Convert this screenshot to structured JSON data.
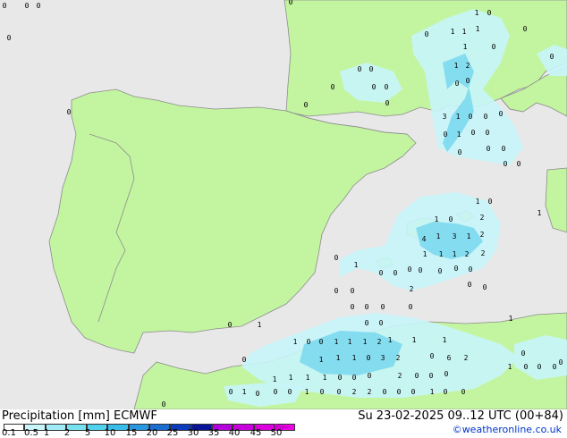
{
  "title": "Precipitation [mm]  ECMWF",
  "valid_time": "Su 23-02-2025 09..12 UTC (00+84)",
  "credit": "©weatheronline.co.uk",
  "legend": {
    "ticks": [
      "0.1",
      "0.5",
      "1",
      "2",
      "5",
      "10",
      "15",
      "20",
      "25",
      "30",
      "35",
      "40",
      "45",
      "50"
    ],
    "colors": [
      "#ffffff",
      "#c8f5fa",
      "#a0ebf5",
      "#78e1f0",
      "#50d2ee",
      "#38bcea",
      "#2896e0",
      "#1a6ed2",
      "#0c3cbe",
      "#0a149a",
      "#b400dc",
      "#c800dc",
      "#dc00dc",
      "#f000e6"
    ]
  },
  "colors": {
    "sea": "#e8e8e8",
    "land": "#c3f5a0",
    "border": "#8c8c8c",
    "precip_light": "#c8f5fa",
    "precip_mid": "#a0ebf5",
    "precip_heavy": "#78d7ee"
  },
  "map_labels": [
    "0",
    "0",
    "0",
    "0",
    "0",
    "0",
    "1",
    "0",
    "0",
    "1",
    "1",
    "1",
    "1",
    "1",
    "2",
    "0",
    "0",
    "0",
    "0",
    "0",
    "0",
    "0",
    "0",
    "0",
    "0",
    "0",
    "0",
    "3",
    "1",
    "0",
    "0",
    "0",
    "0",
    "1",
    "0",
    "0",
    "0",
    "0",
    "0",
    "0",
    "0",
    "1",
    "0",
    "1",
    "0",
    "2",
    "4",
    "1",
    "3",
    "1",
    "2",
    "2",
    "1",
    "1",
    "1",
    "2",
    "1",
    "0",
    "1",
    "0",
    "0",
    "0",
    "0",
    "0",
    "0",
    "0",
    "2",
    "0",
    "0",
    "0",
    "0",
    "0",
    "0",
    "0",
    "0",
    "0",
    "0",
    "0",
    "1",
    "1",
    "0",
    "0",
    "1",
    "1",
    "1",
    "2",
    "1",
    "1",
    "1",
    "1",
    "0",
    "1",
    "1",
    "1",
    "0",
    "3",
    "2",
    "0",
    "6",
    "2",
    "1",
    "1",
    "1",
    "1",
    "0",
    "0",
    "0",
    "2",
    "0",
    "0",
    "0",
    "0",
    "1",
    "0",
    "0",
    "0",
    "1",
    "0",
    "0",
    "2",
    "2",
    "0",
    "0",
    "0",
    "1",
    "0",
    "0",
    "1",
    "0",
    "0",
    "0",
    "0",
    "0",
    "0"
  ]
}
